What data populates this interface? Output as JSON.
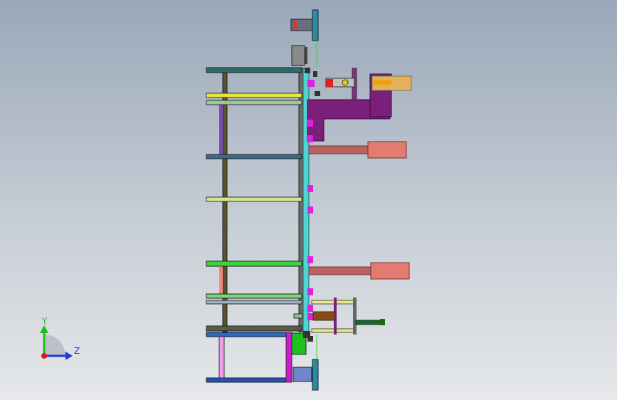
{
  "window": {
    "title": ""
  },
  "triad": {
    "y_label": "Y",
    "z_label": "Z",
    "y_color": "#22bb22",
    "z_color": "#1a3fd6",
    "x_color": "#e01818"
  },
  "palette": {
    "frame_dark": "#3a3a2a",
    "frame_olive": "#5b5630",
    "accent_magenta": "#cc1acc",
    "accent_purple": "#7a1f7a",
    "cylinder_salmon": "#e27b70",
    "rod_brown": "#b86262",
    "plate_cyan": "#4fd4d4",
    "rail_yellow": "#e7e83a",
    "rail_green": "#3bd43b",
    "rail_blue": "#2b66c9",
    "rail_pink": "#f09ce8"
  }
}
